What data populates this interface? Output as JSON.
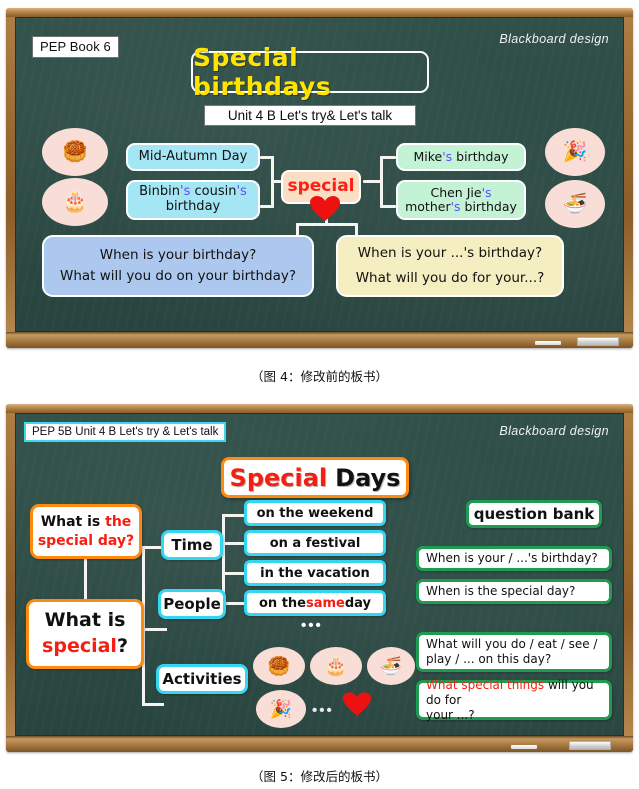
{
  "figure1": {
    "board_label": "PEP Book 6",
    "design_note": "Blackboard  design",
    "title": "Special birthdays",
    "subtitle": "Unit 4 B Let's try& Let's talk",
    "center_node": "special",
    "left_nodes": [
      {
        "line1": "Mid-Autumn Day",
        "line2": ""
      },
      {
        "line1": "Binbin's cousin's",
        "line2": "birthday"
      }
    ],
    "right_nodes": [
      {
        "line1": "Mike's birthday",
        "line2": ""
      },
      {
        "line1": "Chen Jie's",
        "line2": "mother's birthday"
      }
    ],
    "bottom_left": {
      "line1": "When is your birthday?",
      "line2": "What will you do on your birthday?"
    },
    "bottom_right": {
      "line1": "When is your ...'s birthday?",
      "line2": "What will you do for your...?"
    },
    "clipart_left": [
      "mooncakes-icon",
      "birthday-cake-icon"
    ],
    "clipart_right": [
      "party-kids-icon",
      "noodle-bowl-icon"
    ],
    "caption": "（图 4：修改前的板书）"
  },
  "figure2": {
    "board_label": "PEP 5B Unit 4 B Let's try & Let's talk",
    "design_note": "Blackboard  design",
    "title_red": "Special",
    "title_black": "Days",
    "prompt_top": {
      "line1_black": "What is ",
      "line1_red": "the",
      "line2_red": "special day?"
    },
    "prompt_main": {
      "line1": "What is",
      "line2_red": "special",
      "line2_tail": "?"
    },
    "branches": [
      "Time",
      "People",
      "Activities"
    ],
    "time_items": [
      {
        "text": "on the weekend",
        "highlight": ""
      },
      {
        "text": "on a festival",
        "highlight": ""
      },
      {
        "text": "in the vacation",
        "highlight": ""
      },
      {
        "pre": "on the ",
        "highlight": "same",
        "post": " day"
      }
    ],
    "time_ellipsis": "•••",
    "activities_ellipsis": "•••",
    "question_bank_title": "question bank",
    "questions": [
      {
        "text": "When is your / ...'s birthday?",
        "red_prefix": ""
      },
      {
        "text": "When is the special day?",
        "red_prefix": ""
      },
      {
        "text": "What will you do / eat / see /\nplay / ... on this day?",
        "red_prefix": ""
      },
      {
        "red_prefix": "What special things",
        "text": " will you do for\nyour ...?"
      }
    ],
    "clipart": [
      "mooncakes-icon",
      "birthday-cake-icon",
      "noodle-bowl-icon",
      "party-kids-icon",
      "heart-icon"
    ],
    "caption": "（图 5：修改后的板书）"
  },
  "colors": {
    "slate": "#2c4a44",
    "frame": "#a8763c",
    "cyan": "#35d6f2",
    "orange": "#ff8a10",
    "green": "#1f9b52",
    "red": "#f51e10",
    "yellow_title": "#ffe400",
    "peach": "#fbdfc4",
    "heart": "#ee1111"
  }
}
